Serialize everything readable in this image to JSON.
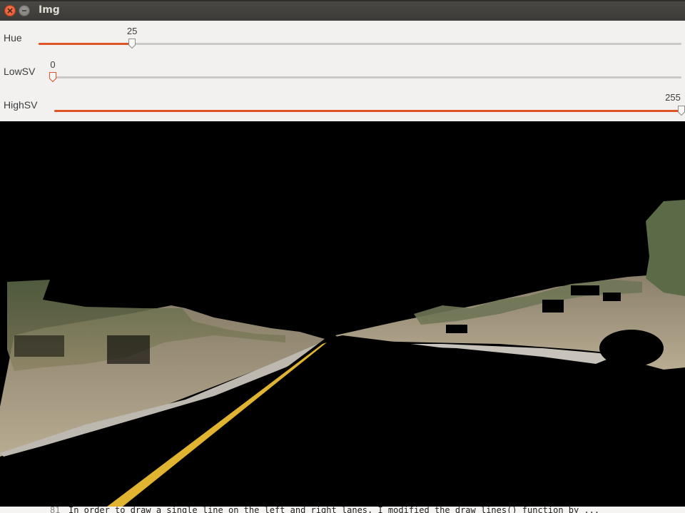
{
  "window": {
    "title": "Img"
  },
  "trackbars": [
    {
      "label": "Hue",
      "value": "25",
      "fraction": 0.1455
    },
    {
      "label": "LowSV",
      "value": "0",
      "fraction": 0.0
    },
    {
      "label": "HighSV",
      "value": "255",
      "fraction": 1.0
    }
  ],
  "background_text": {
    "line_number": "81",
    "line": "In order to draw a single line on the left and right lanes, I modified the draw lines() function by ..."
  },
  "colors": {
    "accent": "#df5326",
    "titlebar": "#3c3b37",
    "panel": "#f2f1f0",
    "image_background": "#000000",
    "lane_line": "#e0b431"
  },
  "image": {
    "description_icon": "road-mask-image"
  }
}
